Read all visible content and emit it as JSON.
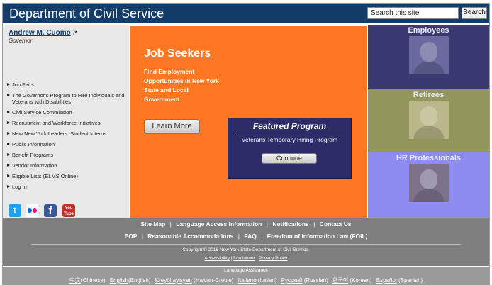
{
  "header": {
    "title": "Department of Civil Service",
    "search_placeholder": "Search this site",
    "search_button": "Search"
  },
  "sidebar": {
    "governor_name": "Andrew M. Cuomo",
    "governor_title": "Governor",
    "items": [
      "Job Fairs",
      "The Governor's Program to Hire Individuals and Veterans with Disabilities",
      "Civil Service Commission",
      "Recruitment and Workforce Initiatives",
      "New New York Leaders: Student Interns",
      "Public Information",
      "Benefit Programs",
      "Vendor Information",
      "Eligible Lists (ELMS Online)",
      "Log In"
    ],
    "social": {
      "twitter_glyph": "t",
      "facebook_glyph": "f",
      "youtube_line1": "You",
      "youtube_line2": "Tube"
    }
  },
  "hero": {
    "title": "Job Seekers",
    "subtitle": "Find Employment Opportunities in New York State and Local Government",
    "learn_more": "Learn More",
    "featured_title": "Featured Program",
    "featured_subtitle": "Veterans Temporary Hiring Program",
    "continue": "Continue",
    "color": "#ff7722"
  },
  "panels": {
    "employees": "Employees",
    "retirees": "Retirees",
    "hr": "HR Professionals"
  },
  "footer": {
    "row1": [
      "Site Map",
      "Language Access Information",
      "Notifications",
      "Contact Us"
    ],
    "row2": [
      "EOP",
      "Reasonable Accommodations",
      "FAQ",
      "Freedom of Information Law (FOIL)"
    ],
    "separator": "|",
    "copyright": "Copyright © 2016 New York State Department of Civil Service.",
    "links": [
      "Accessibility",
      "Disclaimer",
      "Privacy Policy"
    ],
    "language_title": "Language Assistance",
    "languages": [
      {
        "native": "中文",
        "label": "(Chinese)"
      },
      {
        "native": "English",
        "label": "(English)"
      },
      {
        "native": "Kreyòl ayisyen",
        "label": "(Haitian-Creole)"
      },
      {
        "native": "Italiano",
        "label": "(Italian)"
      },
      {
        "native": "Русский",
        "label": "(Russian)"
      },
      {
        "native": "한국어",
        "label": "(Korean)"
      },
      {
        "native": "Español",
        "label": "(Spanish)"
      }
    ]
  },
  "colors": {
    "header": "#133c69",
    "hero": "#ff7722",
    "featured": "#2c2c68",
    "employees": "#3a3a72",
    "retirees": "#93965a",
    "hr": "#8d8df1",
    "footer": "#7e7e7e"
  },
  "icons": {
    "external_link": "external-link-icon",
    "bullet": "triangle-right-icon",
    "twitter": "twitter-icon",
    "flickr": "flickr-icon",
    "facebook": "facebook-icon",
    "youtube": "youtube-icon"
  }
}
